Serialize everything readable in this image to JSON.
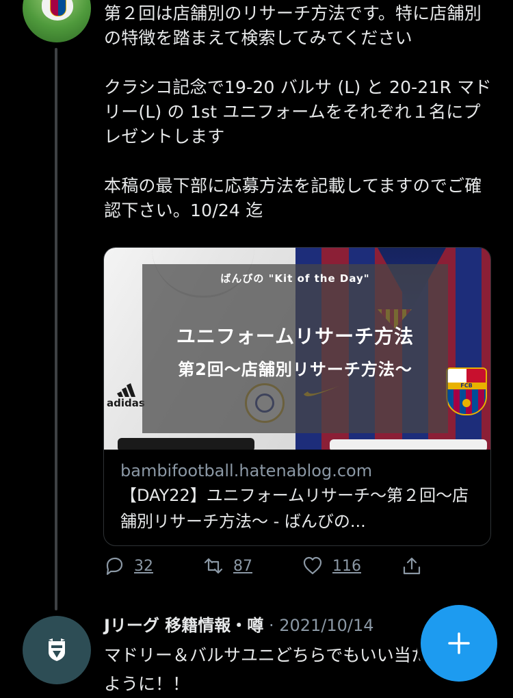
{
  "tweet1": {
    "text": "第２回は店舗別のリサーチ方法です。特に店舗別の特徴を踏まえて検索してみてください\n\nクラシコ記念で19-20 バルサ (L) と 20-21R マドリー(L) の 1st ユニフォームをそれぞれ１名にプレゼントします\n\n本稿の最下部に応募方法を記載してますのでご確認下さい。10/24 迄",
    "avatar_icon": "fc-barcelona-avatar",
    "card": {
      "image": {
        "overlay_sub": "ばんびの \"Kit of the Day\"",
        "overlay_title": "ユニフォームリサーチ方法",
        "overlay_subtitle": "第2回〜店舗別リサーチ方法〜",
        "brand_left": "adidas"
      },
      "domain": "bambifootball.hatenablog.com",
      "title": "【DAY22】ユニフォームリサーチ〜第２回〜店舗別リサーチ方法〜 - ばんびの..."
    },
    "actions": {
      "reply_count": "32",
      "retweet_count": "87",
      "like_count": "116"
    }
  },
  "tweet2": {
    "name": "Jリーグ 移籍情報・噂",
    "meta": "· 2021/10/14",
    "text": "マドリー＆バルサユニどちらでもいい当たりますように！！",
    "avatar_icon": "club-emblem-avatar"
  },
  "fab": {
    "icon": "plus-icon"
  },
  "colors": {
    "background": "#000000",
    "text": "#e7e9ea",
    "secondary": "#8b98a5",
    "accent": "#1d9bf0",
    "border": "#2f3336"
  }
}
